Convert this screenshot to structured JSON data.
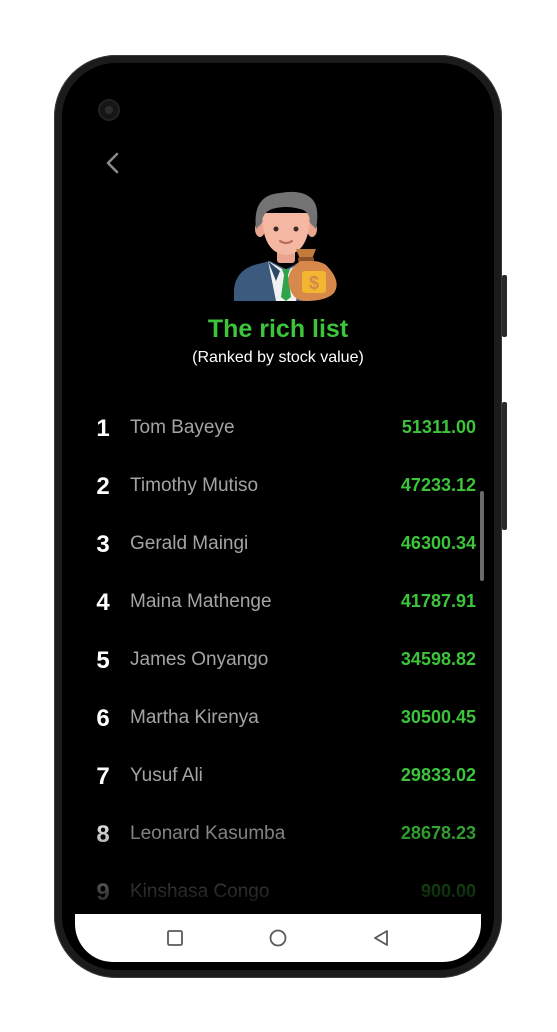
{
  "header": {
    "title": "The rich list",
    "subtitle": "(Ranked by stock value)"
  },
  "leaderboard": [
    {
      "rank": "1",
      "name": "Tom Bayeye",
      "value": "51311.00"
    },
    {
      "rank": "2",
      "name": "Timothy Mutiso",
      "value": "47233.12"
    },
    {
      "rank": "3",
      "name": "Gerald Maingi",
      "value": "46300.34"
    },
    {
      "rank": "4",
      "name": "Maina Mathenge",
      "value": "41787.91"
    },
    {
      "rank": "5",
      "name": "James Onyango",
      "value": "34598.82"
    },
    {
      "rank": "6",
      "name": "Martha Kirenya",
      "value": "30500.45"
    },
    {
      "rank": "7",
      "name": "Yusuf Ali",
      "value": "29833.02"
    },
    {
      "rank": "8",
      "name": "Leonard Kasumba",
      "value": "28678.23"
    },
    {
      "rank": "9",
      "name": "Kinshasa Congo",
      "value": "900.00"
    }
  ],
  "icons": {
    "back": "chevron-left-icon",
    "illustration": "businessman-money-bag-icon",
    "nav_recents": "square-icon",
    "nav_home": "circle-icon",
    "nav_back": "triangle-back-icon"
  },
  "colors": {
    "accent": "#3cc43a",
    "background": "#000000",
    "name_text": "#a4a4a4"
  }
}
